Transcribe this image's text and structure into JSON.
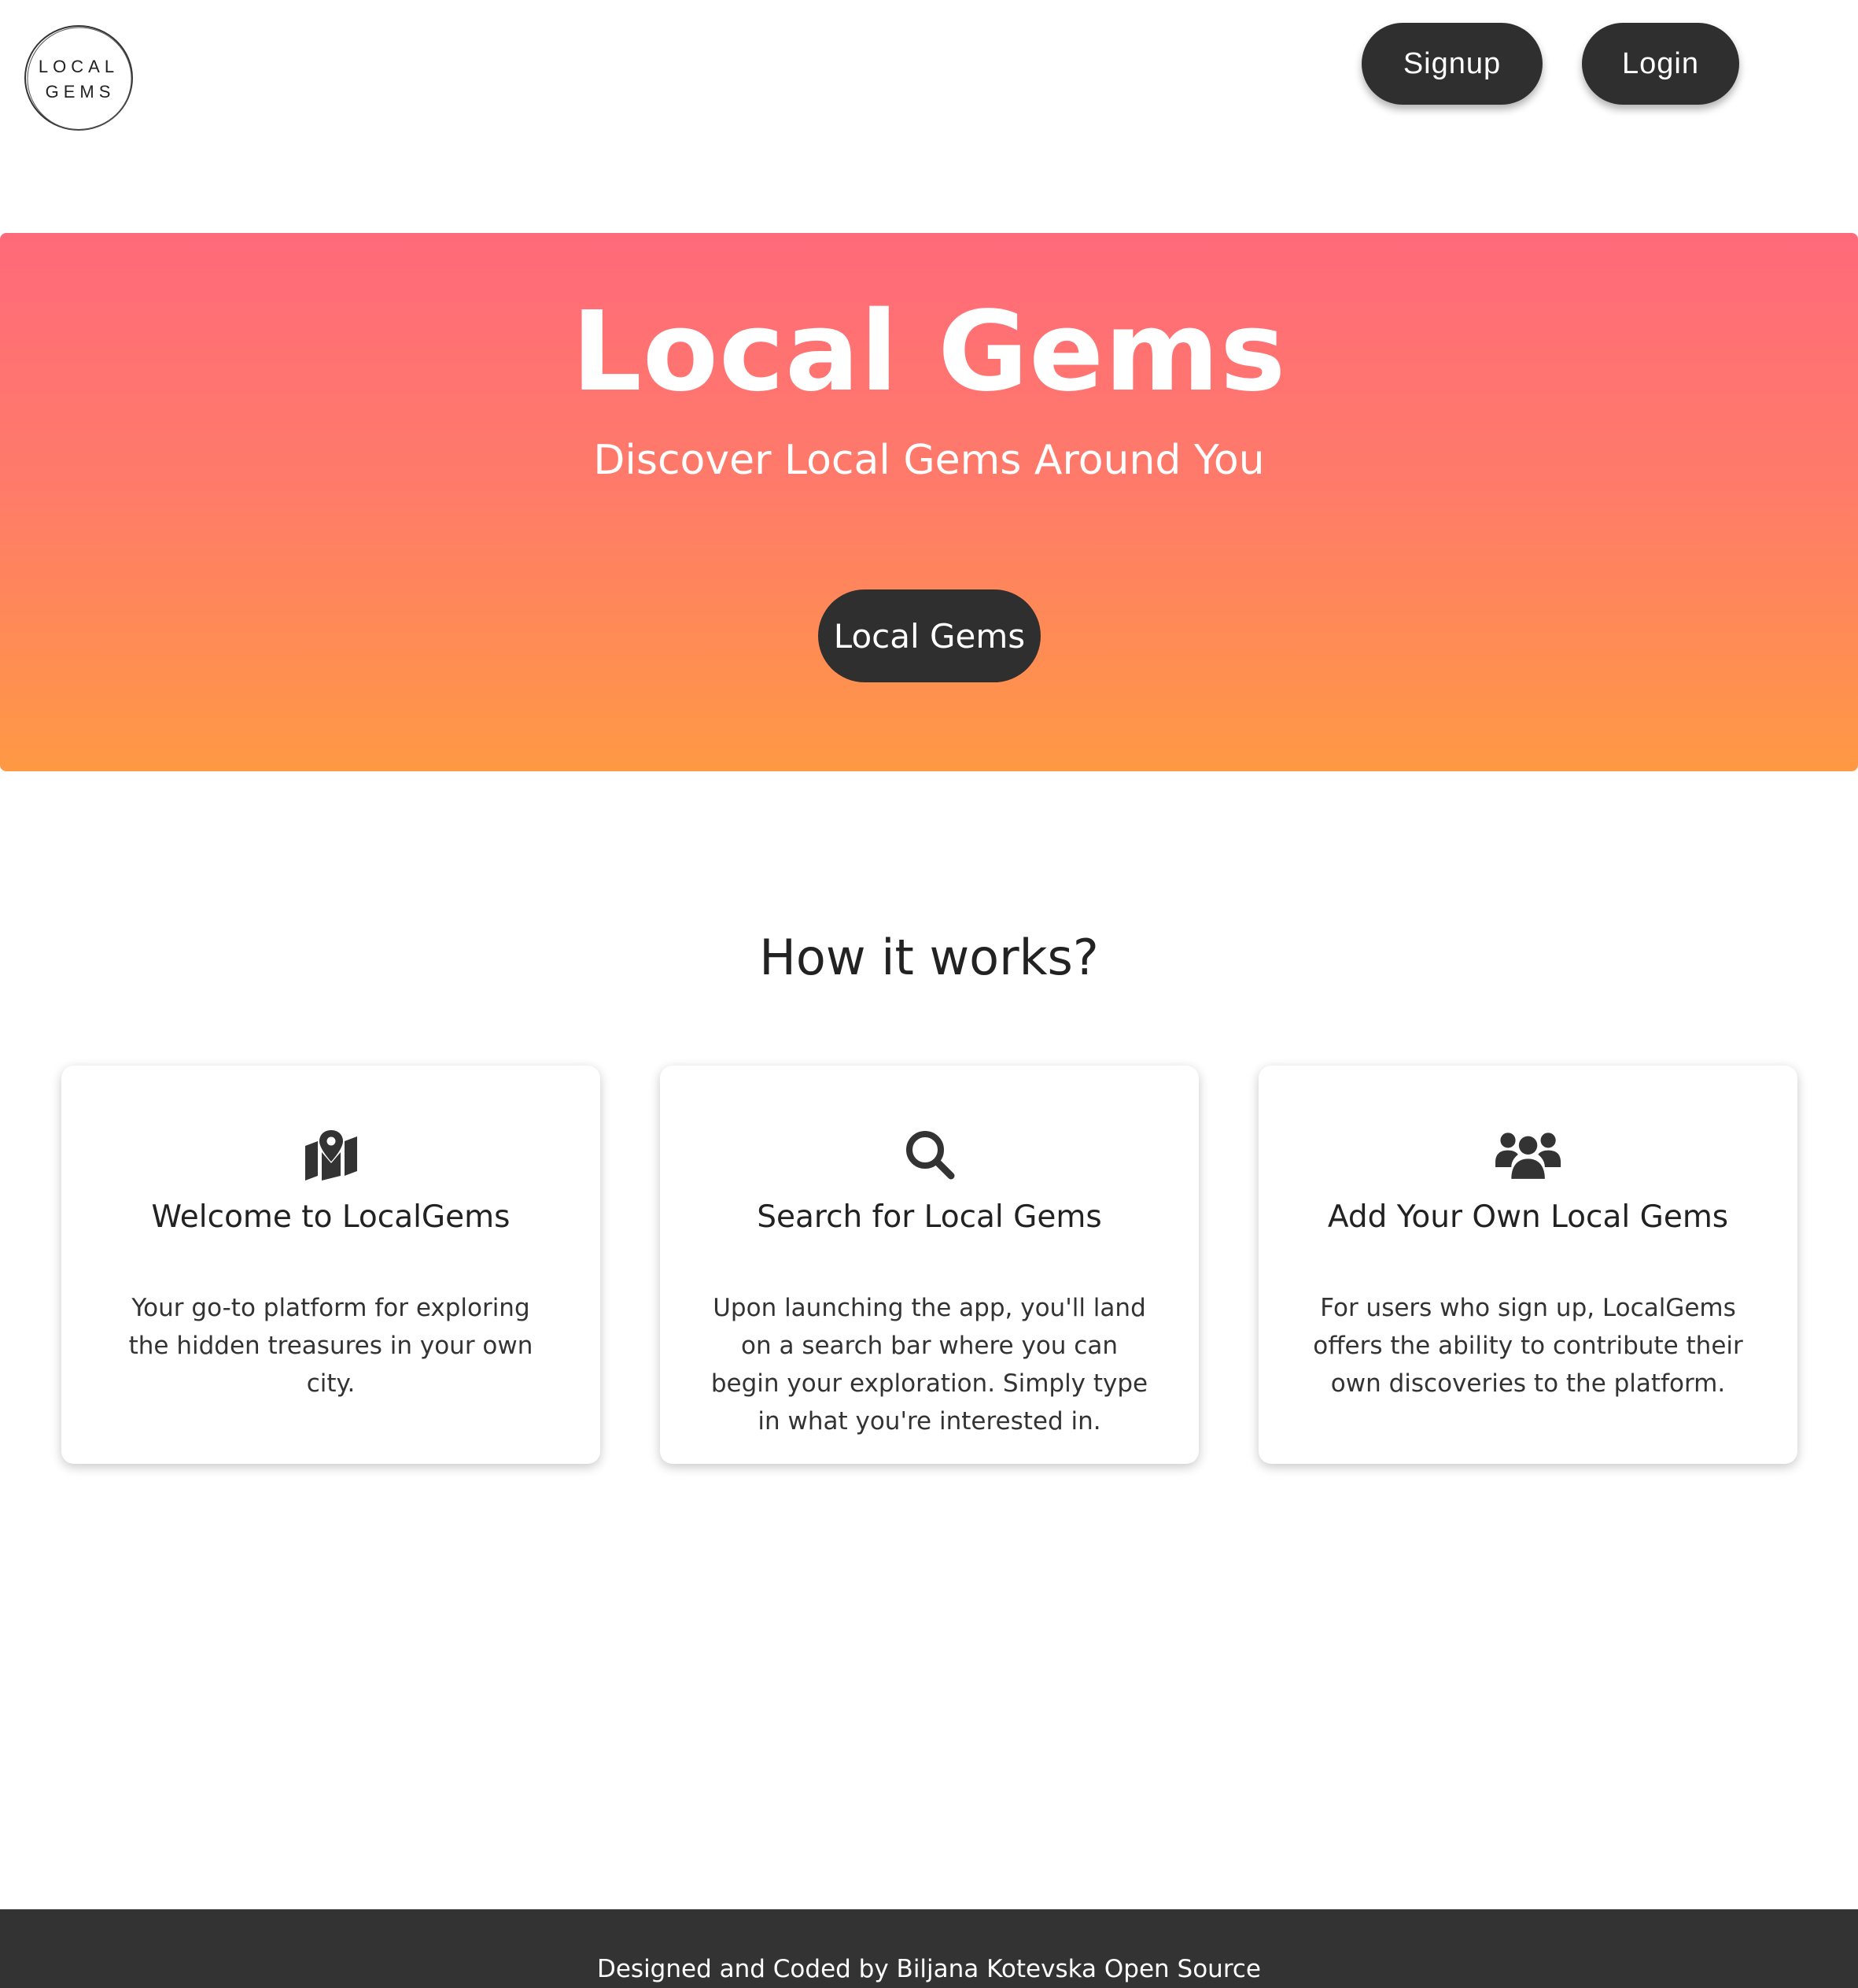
{
  "header": {
    "logo_line1": "LOCAL",
    "logo_line2": "GEMS",
    "signup_label": "Signup",
    "login_label": "Login"
  },
  "hero": {
    "title": "Local Gems",
    "subtitle": "Discover Local Gems Around You",
    "cta_label": "Local Gems"
  },
  "how_it_works": {
    "title": "How it works?",
    "cards": [
      {
        "icon": "map-location-icon",
        "title": "Welcome to LocalGems",
        "text": "Your go-to platform for exploring the hidden treasures in your own city."
      },
      {
        "icon": "search-icon",
        "title": "Search for Local Gems",
        "text": "Upon launching the app, you'll land on a search bar where you can begin your exploration. Simply type in what you're interested in."
      },
      {
        "icon": "users-icon",
        "title": "Add Your Own Local Gems",
        "text": "For users who sign up, LocalGems offers the ability to contribute their own discoveries to the platform."
      }
    ]
  },
  "footer": {
    "text": "Designed and Coded by Biljana Kotevska Open Source"
  },
  "colors": {
    "dark": "#2f2f2f",
    "hero_top": "#ff6a7a",
    "hero_bottom": "#ff9944",
    "footer_bg": "#333333"
  }
}
